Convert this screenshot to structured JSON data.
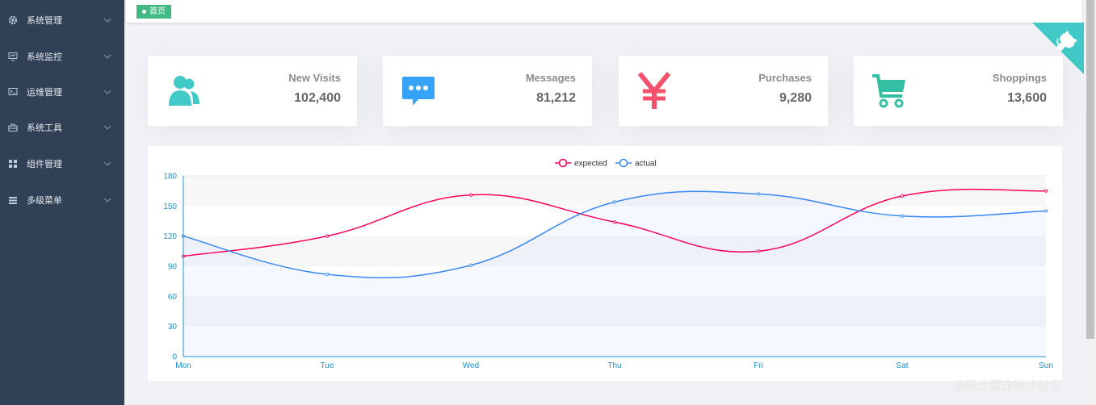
{
  "sidebar": {
    "items": [
      {
        "label": "系统管理",
        "icon": "gear-icon"
      },
      {
        "label": "系统监控",
        "icon": "monitor-icon"
      },
      {
        "label": "运维管理",
        "icon": "terminal-icon"
      },
      {
        "label": "系统工具",
        "icon": "toolbox-icon"
      },
      {
        "label": "组件管理",
        "icon": "grid-icon"
      },
      {
        "label": "多级菜单",
        "icon": "list-icon"
      }
    ]
  },
  "tags_view": {
    "tabs": [
      {
        "label": "首页",
        "active": true
      }
    ]
  },
  "panels": [
    {
      "label": "New Visits",
      "value": "102,400",
      "icon": "peoples-icon",
      "color": "#40c9c6"
    },
    {
      "label": "Messages",
      "value": "81,212",
      "icon": "message-icon",
      "color": "#36a3f7"
    },
    {
      "label": "Purchases",
      "value": "9,280",
      "icon": "money-icon",
      "color": "#f4516c"
    },
    {
      "label": "Shoppings",
      "value": "13,600",
      "icon": "shopping-cart-icon",
      "color": "#34bfa3"
    }
  ],
  "chart_data": {
    "type": "line",
    "categories": [
      "Mon",
      "Tue",
      "Wed",
      "Thu",
      "Fri",
      "Sat",
      "Sun"
    ],
    "series": [
      {
        "name": "expected",
        "values": [
          100,
          120,
          161,
          134,
          105,
          160,
          165
        ],
        "color": "#FF005A"
      },
      {
        "name": "actual",
        "values": [
          120,
          82,
          91,
          154,
          162,
          140,
          145
        ],
        "color": "#3888fa"
      }
    ],
    "y_ticks": [
      0,
      30,
      60,
      90,
      120,
      150,
      180
    ],
    "ylim": [
      0,
      180
    ],
    "legend_position": "top-center",
    "smooth": true,
    "axis_color": "#1f8fd1"
  },
  "watermark": "@稀土掘金技术社区",
  "colors": {
    "sidebar_bg": "#304156",
    "tag_active": "#42b983",
    "github_corner": "#40c9c6"
  }
}
